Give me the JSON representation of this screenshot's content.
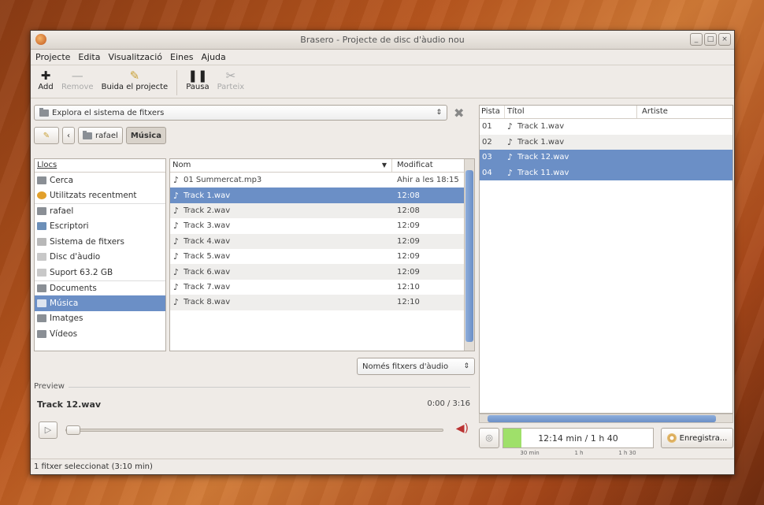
{
  "window": {
    "title": "Brasero - Projecte de disc d'àudio nou"
  },
  "menu": [
    "Projecte",
    "Edita",
    "Visualització",
    "Eines",
    "Ajuda"
  ],
  "toolbar": {
    "add": "Add",
    "remove": "Remove",
    "clear": "Buida el projecte",
    "pause": "Pausa",
    "split": "Parteix"
  },
  "browser": {
    "combo_label": "Explora el sistema de fitxers",
    "path": [
      "rafael",
      "Música"
    ]
  },
  "places": {
    "header": "Llocs",
    "items": [
      {
        "label": "Cerca",
        "icon": "search-icon"
      },
      {
        "label": "Utilitzats recentment",
        "icon": "recent-icon"
      },
      {
        "label": "rafael",
        "icon": "folder-icon"
      },
      {
        "label": "Escriptori",
        "icon": "desktop-icon"
      },
      {
        "label": "Sistema de fitxers",
        "icon": "drive-icon"
      },
      {
        "label": "Disc d'àudio",
        "icon": "disc-icon"
      },
      {
        "label": "Suport 63.2 GB",
        "icon": "drive-icon"
      },
      {
        "label": "Documents",
        "icon": "folder-icon"
      },
      {
        "label": "Música",
        "icon": "folder-icon"
      },
      {
        "label": "Imatges",
        "icon": "folder-icon"
      },
      {
        "label": "Vídeos",
        "icon": "folder-icon"
      }
    ]
  },
  "files": {
    "col_name": "Nom",
    "col_modified": "Modificat",
    "rows": [
      {
        "name": "01 Summercat.mp3",
        "modified": "Ahir a les 18:15"
      },
      {
        "name": "Track 1.wav",
        "modified": "12:08"
      },
      {
        "name": "Track 2.wav",
        "modified": "12:08"
      },
      {
        "name": "Track 3.wav",
        "modified": "12:09"
      },
      {
        "name": "Track 4.wav",
        "modified": "12:09"
      },
      {
        "name": "Track 5.wav",
        "modified": "12:09"
      },
      {
        "name": "Track 6.wav",
        "modified": "12:09"
      },
      {
        "name": "Track 7.wav",
        "modified": "12:10"
      },
      {
        "name": "Track 8.wav",
        "modified": "12:10"
      }
    ],
    "filter": "Només fitxers d'àudio"
  },
  "preview": {
    "label": "Preview",
    "track": "Track 12.wav",
    "time": "0:00 / 3:16"
  },
  "status": "1 fitxer seleccionat (3:10 min)",
  "tracks": {
    "col_num": "Pista",
    "col_title": "Títol",
    "col_artist": "Artiste",
    "rows": [
      {
        "num": "01",
        "title": "Track 1.wav"
      },
      {
        "num": "02",
        "title": "Track 1.wav"
      },
      {
        "num": "03",
        "title": "Track 12.wav"
      },
      {
        "num": "04",
        "title": "Track 11.wav"
      }
    ]
  },
  "disc": {
    "usage": "12:14 min / 1 h 40",
    "usage_fraction": 0.12,
    "ticks": [
      "30 min",
      "1 h",
      "1 h 30"
    ],
    "burn_label": "Enregistra..."
  }
}
